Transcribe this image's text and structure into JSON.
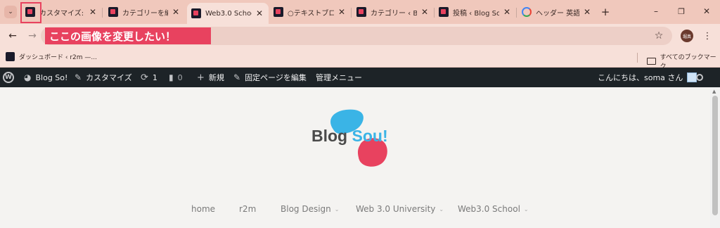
{
  "browser": {
    "tabs": [
      {
        "label": "カスタマイズ: Blo"
      },
      {
        "label": "カテゴリーを編集"
      },
      {
        "label": "Web3.0 Schoo"
      },
      {
        "label": "○テキストブロッ"
      },
      {
        "label": "カテゴリー ‹ Blog"
      },
      {
        "label": "投稿 ‹ Blog So"
      },
      {
        "label": "ヘッダー 英語 -"
      }
    ],
    "new_tab": "+",
    "window_controls": {
      "minimize": "–",
      "maximize": "❐",
      "close": "✕"
    },
    "address_overlay": "ここの画像を変更したい！",
    "profile_initials": "堀真",
    "bookmarks": [
      {
        "label": "ダッシュボード ‹ r2m —..."
      }
    ],
    "all_bookmarks": "すべてのブックマーク"
  },
  "wp_admin": {
    "site_name": "Blog So!",
    "customize": "カスタマイズ",
    "updates_count": "1",
    "comments_count": "0",
    "new": "新規",
    "edit_page": "固定ページを編集",
    "admin_menu": "管理メニュー",
    "greeting": "こんにちは、soma さん"
  },
  "site": {
    "logo_text_dark": "Blog ",
    "logo_text_accent": "Sou!",
    "nav": [
      {
        "label": "home",
        "has_dropdown": false
      },
      {
        "label": "r2m",
        "has_dropdown": false
      },
      {
        "label": "Blog Design",
        "has_dropdown": true
      },
      {
        "label": "Web 3.0 University",
        "has_dropdown": true
      },
      {
        "label": "Web3.0 School",
        "has_dropdown": true
      }
    ]
  },
  "colors": {
    "tab_strip": "#f0c8bc",
    "highlight_box": "#e8425f",
    "logo_blue": "#3ab4e6",
    "logo_red": "#e8425f"
  }
}
